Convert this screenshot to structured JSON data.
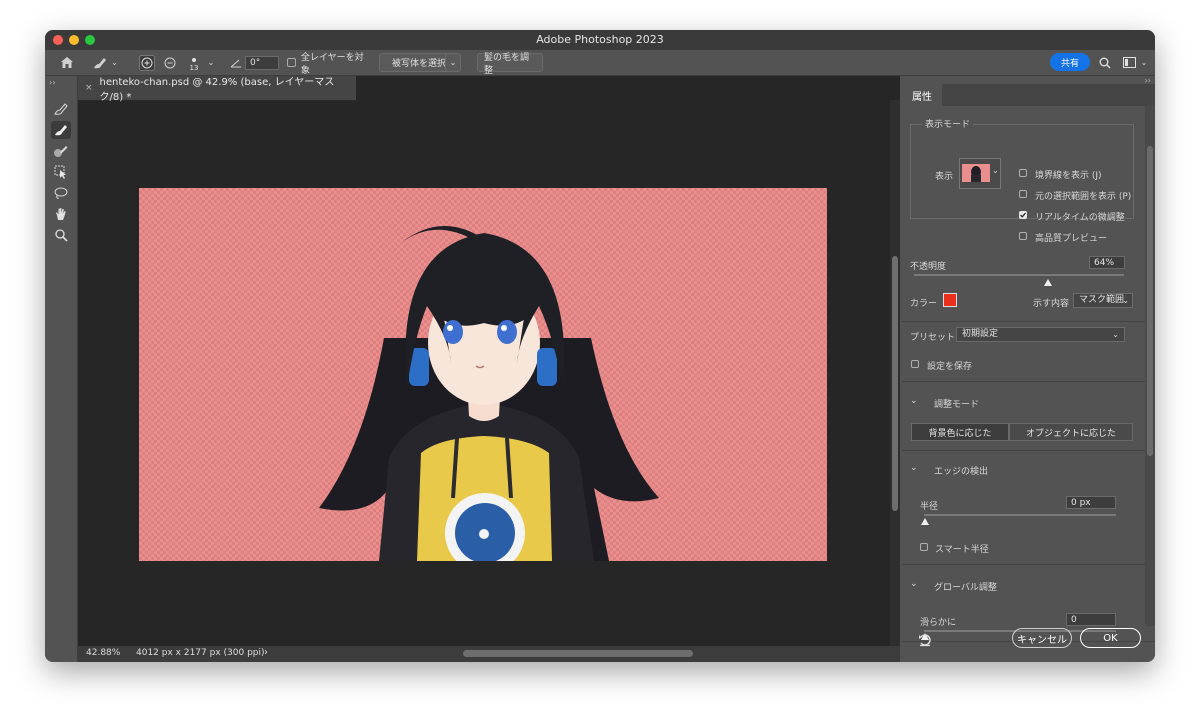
{
  "window": {
    "title": "Adobe Photoshop 2023"
  },
  "options_bar": {
    "angle_value": "0°",
    "brush_size": "13",
    "sample_all_layers_label": "全レイヤーを対象",
    "select_subject_label": "被写体を選択",
    "refine_hair_label": "髪の毛を調整",
    "share_label": "共有"
  },
  "document": {
    "tab_title": "henteko-chan.psd @ 42.9% (base, レイヤーマスク/8) *",
    "close_glyph": "×",
    "zoom": "42.88%",
    "dimensions": "4012 px x 2177 px (300 ppi)",
    "status_arrow": "›"
  },
  "properties": {
    "tab_label": "属性",
    "view_mode": {
      "section_label": "表示モード",
      "view_label": "表示",
      "options": [
        {
          "label": "境界線を表示 (J)",
          "checked": false
        },
        {
          "label": "元の選択範囲を表示 (P)",
          "checked": false
        },
        {
          "label": "リアルタイムの微調整",
          "checked": true
        },
        {
          "label": "高品質プレビュー",
          "checked": false
        }
      ]
    },
    "opacity_label": "不透明度",
    "opacity_value": "64%",
    "opacity_fraction": 0.64,
    "color_label": "カラー",
    "color_hex": "#e8301c",
    "indicates_label": "示す内容",
    "indicates_value": "マスク範囲",
    "preset_label": "プリセット",
    "preset_value": "初期設定",
    "save_settings_label": "設定を保存",
    "refine_mode": {
      "section_label": "調整モード",
      "options": [
        "背景色に応じた",
        "オブジェクトに応じた"
      ]
    },
    "edge_detection": {
      "section_label": "エッジの検出",
      "radius_label": "半径",
      "radius_value": "0 px",
      "smart_radius_label": "スマート半径"
    },
    "global_refinements": {
      "section_label": "グローバル調整",
      "smooth_label": "滑らかに",
      "smooth_value": "0"
    },
    "cancel_label": "キャンセル",
    "ok_label": "OK"
  },
  "colors": {
    "accent_blue": "#1473e6",
    "overlay_pink": "#ea8e8e",
    "panel_bg": "#535353",
    "canvas_bg": "#262626"
  }
}
